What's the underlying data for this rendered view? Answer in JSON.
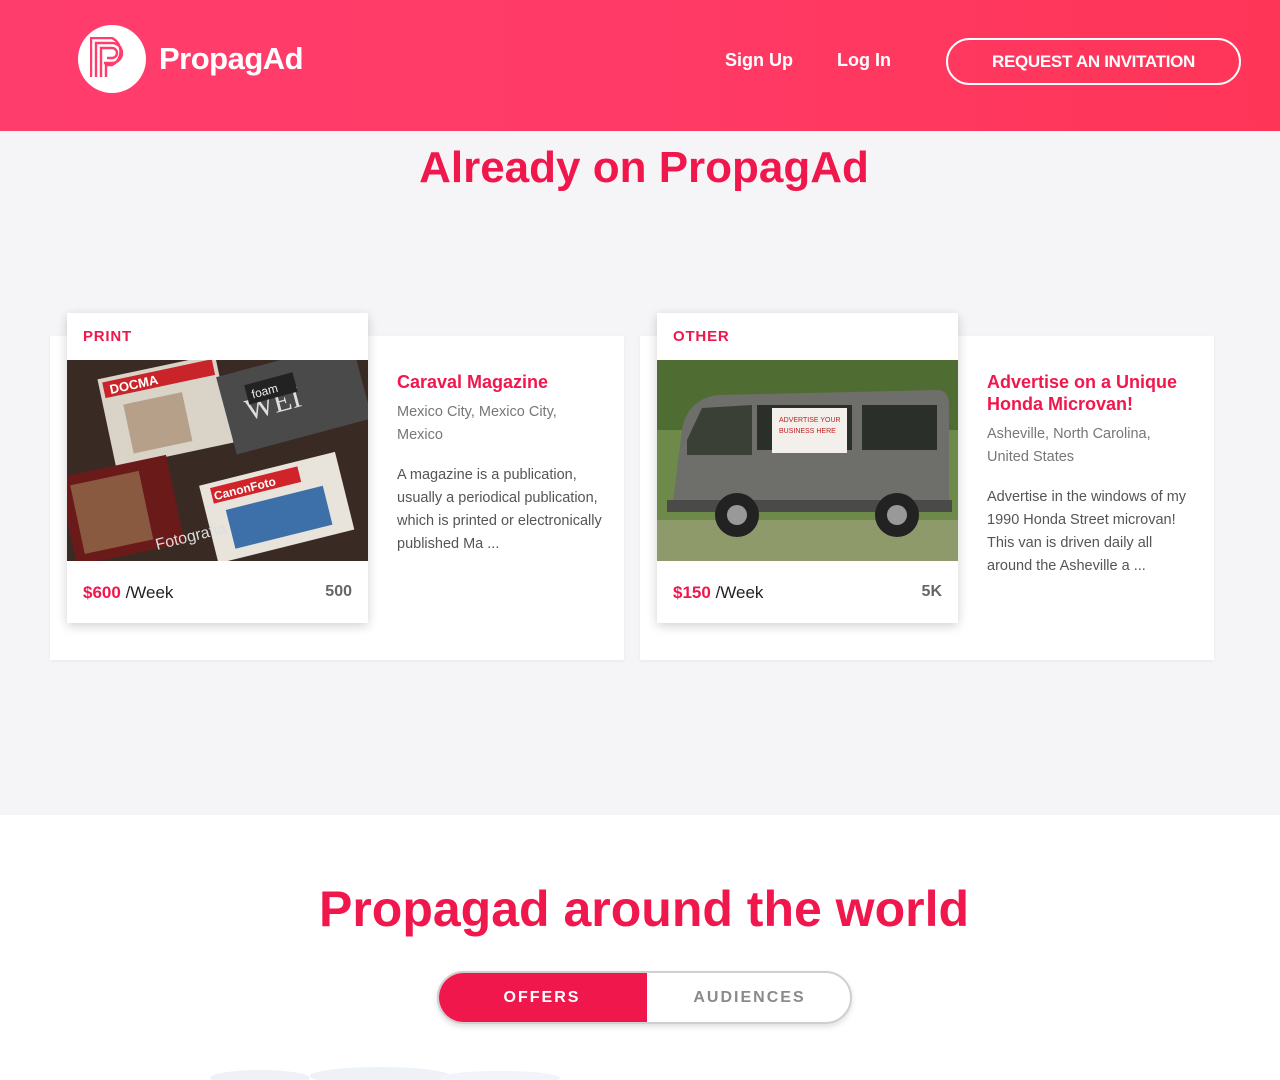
{
  "header": {
    "brand": "PropagAd",
    "nav": {
      "signup": "Sign Up",
      "login": "Log In"
    },
    "cta": "REQUEST AN INVITATION"
  },
  "already": {
    "title": "Already on PropagAd",
    "listings": [
      {
        "category": "PRINT",
        "title": "Caraval Magazine",
        "location": "Mexico City, Mexico City, Mexico",
        "description": "A magazine is a publication, usually a periodical publication, which is printed or electronically published Ma ...",
        "price": "$600",
        "period": "/Week",
        "reach": "500",
        "image_icon": "magazines-photo"
      },
      {
        "category": "OTHER",
        "title": "Advertise on a Unique Honda Microvan!",
        "location": "Asheville, North Carolina, United States",
        "description": "Advertise in the windows of my 1990 Honda Street microvan! This van is driven daily all around the Asheville a ...",
        "price": "$150",
        "period": "/Week",
        "reach": "5K",
        "image_icon": "microvan-photo"
      }
    ]
  },
  "world": {
    "title": "Propagad around the world",
    "tabs": {
      "offers": "OFFERS",
      "audiences": "AUDIENCES"
    }
  },
  "colors": {
    "brand": "#f0174d",
    "header": "#ff3d6c",
    "section_bg": "#f5f5f7"
  }
}
